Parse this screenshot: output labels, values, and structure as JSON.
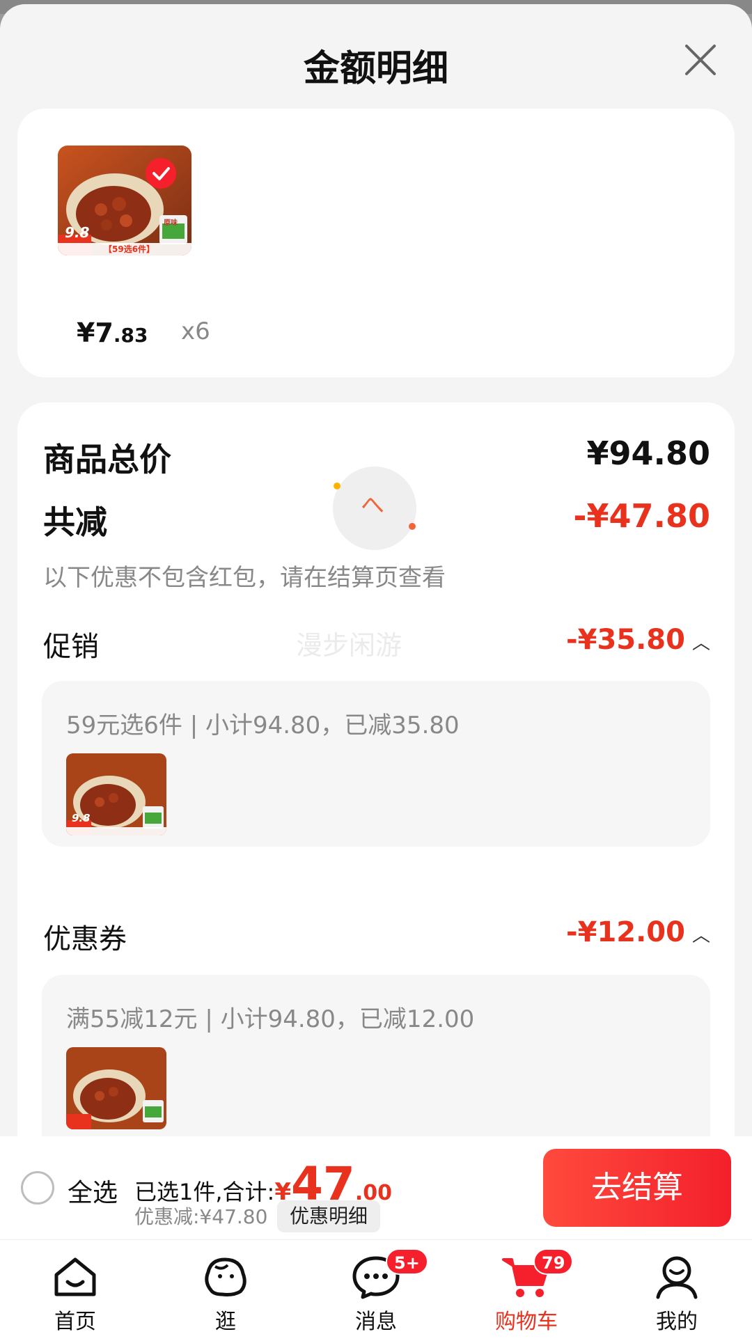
{
  "header": {
    "title": "金额明细"
  },
  "product": {
    "price_symbol": "¥",
    "price_int": "7",
    "price_dec": ".83",
    "quantity": "x6"
  },
  "breakdown": {
    "total_label": "商品总价",
    "total_value": "¥94.80",
    "reduce_label": "共减",
    "reduce_value": "-¥47.80",
    "reduce_hint": "以下优惠不包含红包，请在结算页查看",
    "promo_label": "促销",
    "promo_value": "-¥35.80",
    "promo_desc": "59元选6件 | 小计94.80，已减35.80",
    "coupon_label": "优惠券",
    "coupon_value": "-¥12.00",
    "coupon_desc": "满55减12元 | 小计94.80，已减12.00",
    "watermark": "漫步闲游",
    "loading_glyph": "へ"
  },
  "thumbnail": {
    "badge_price": "9.8",
    "promo_strip": "【59选6件】",
    "pack_text": "原味"
  },
  "checkout": {
    "select_all": "全选",
    "summary_prefix": "已选1件,合计:",
    "currency": "¥",
    "total_int": "47",
    "total_dec": ".00",
    "discount_text": "优惠减:¥47.80",
    "detail_btn": "优惠明细",
    "checkout_btn": "去结算"
  },
  "tabbar": {
    "home": "首页",
    "browse": "逛",
    "messages": "消息",
    "messages_badge": "5+",
    "cart": "购物车",
    "cart_badge": "79",
    "mine": "我的"
  },
  "colors": {
    "accent": "#e8321e",
    "button": "#f3202b"
  },
  "icons": [
    "close-icon",
    "check-icon",
    "caret-up-icon",
    "home-icon",
    "browse-icon",
    "message-icon",
    "cart-icon",
    "user-icon"
  ]
}
